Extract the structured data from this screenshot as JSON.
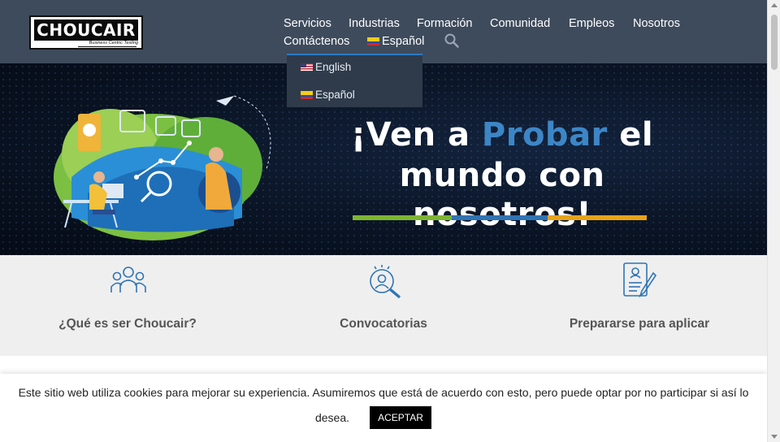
{
  "header": {
    "logo": {
      "text": "CHOUCAIR",
      "tagline": "Business Centric Testing"
    },
    "nav": {
      "servicios": "Servicios",
      "industrias": "Industrias",
      "formacion": "Formación",
      "comunidad": "Comunidad",
      "empleos": "Empleos",
      "nosotros": "Nosotros",
      "contactenos": "Contáctenos",
      "language": "Español"
    },
    "search_icon": "search-icon",
    "colors": {
      "header_bg": "#3e4b5c",
      "dropdown_accent": "#2a7cc7"
    }
  },
  "language_dropdown": {
    "items": [
      {
        "label": "English",
        "flag": "us-flag-icon"
      },
      {
        "label": "Español",
        "flag": "colombia-flag-icon"
      }
    ]
  },
  "hero": {
    "line1_pre": "¡Ven a ",
    "line1_accent": "Probar",
    "line1_post": " el",
    "line2": "mundo con nosotros!",
    "accent_color": "#3d86c6",
    "bar_colors": [
      "#7db530",
      "#2f74b5",
      "#e8a317"
    ]
  },
  "features": [
    {
      "icon": "team-icon",
      "label": "¿Qué es ser Choucair?"
    },
    {
      "icon": "search-user-icon",
      "label": "Convocatorias"
    },
    {
      "icon": "resume-document-icon",
      "label": "Prepararse para aplicar"
    }
  ],
  "cookie_notice": {
    "line1": "Este sitio web utiliza cookies para mejorar su experiencia. Asumiremos que está de acuerdo con esto, pero puede optar por no participar si así lo",
    "line2": "desea.",
    "accept_label": "ACEPTAR"
  }
}
